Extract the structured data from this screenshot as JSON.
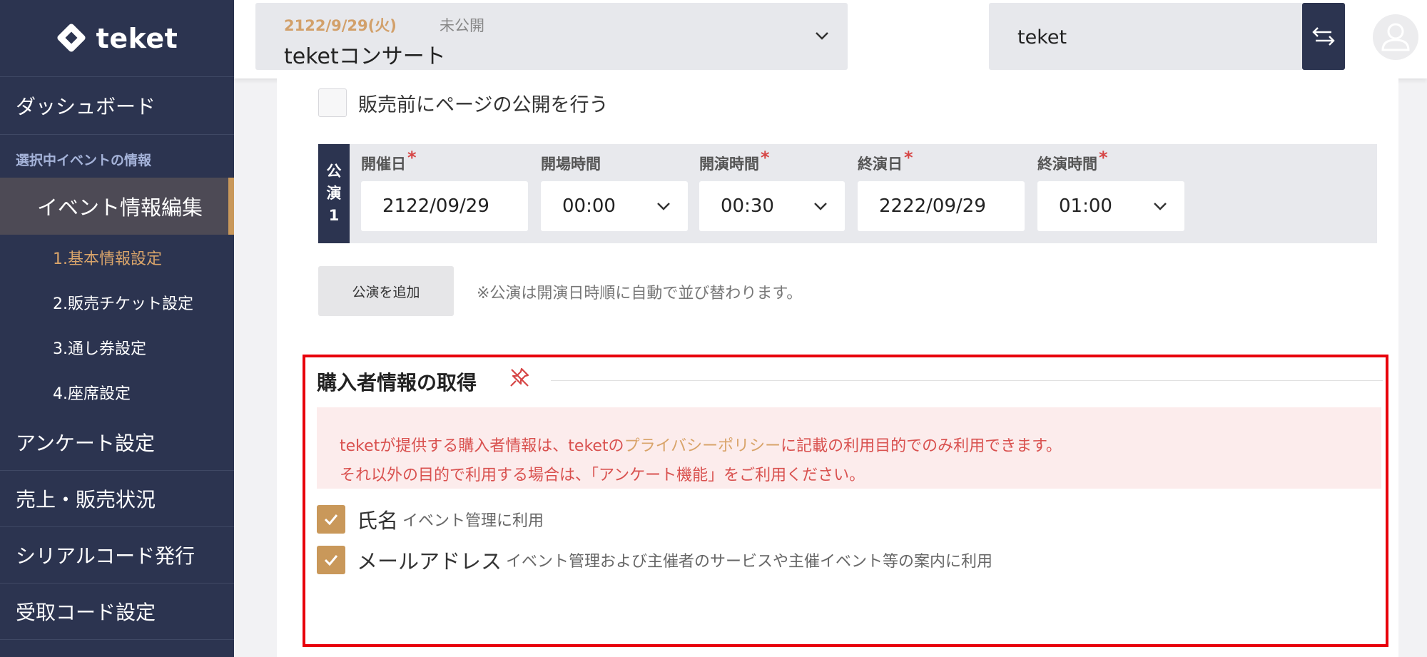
{
  "brand": {
    "name": "teket"
  },
  "sidebar": {
    "dashboard": "ダッシュボード",
    "section_label": "選択中イベントの情報",
    "active_item": "イベント情報編集",
    "sub_items": [
      "1.基本情報設定",
      "2.販売チケット設定",
      "3.通し券設定",
      "4.座席設定"
    ],
    "items": [
      "アンケート設定",
      "売上・販売状況",
      "シリアルコード発行",
      "受取コード設定"
    ]
  },
  "topbar": {
    "event_date": "2122/9/29(火)",
    "event_status": "未公開",
    "event_name": "teketコンサート",
    "organizer": "teket"
  },
  "form": {
    "publish_before_sale_label": "販売前にページの公開を行う",
    "performance": {
      "tag_chars": [
        "公",
        "演",
        "1"
      ],
      "fields": [
        {
          "label": "開催日",
          "required": "*",
          "value": "2122/09/29"
        },
        {
          "label": "開場時間",
          "required": "",
          "value": "00:00"
        },
        {
          "label": "開演時間",
          "required": "*",
          "value": "00:30"
        },
        {
          "label": "終演日",
          "required": "*",
          "value": "2222/09/29"
        },
        {
          "label": "終演時間",
          "required": "*",
          "value": "01:00"
        }
      ]
    },
    "add_performance_button": "公演を追加",
    "add_performance_note": "※公演は開演日時順に自動で並び替わります。"
  },
  "buyer_info": {
    "title": "購入者情報の取得",
    "notice_line1_pre": "teketが提供する購入者情報は、teketの",
    "notice_line1_link": "プライバシーポリシー",
    "notice_line1_post": "に記載の利用目的でのみ利用できます。",
    "notice_line2": "それ以外の目的で利用する場合は、「アンケート機能」をご利用ください。",
    "options": [
      {
        "label": "氏名",
        "desc": "イベント管理に利用",
        "checked": true
      },
      {
        "label": "メールアドレス",
        "desc": "イベント管理および主催者のサービスや主催イベント等の案内に利用",
        "checked": true
      }
    ]
  },
  "colors": {
    "sidebar": "#2c3450",
    "accent": "#c9985a",
    "highlight_border": "#e8000b",
    "notice_bg": "#fcecec"
  }
}
